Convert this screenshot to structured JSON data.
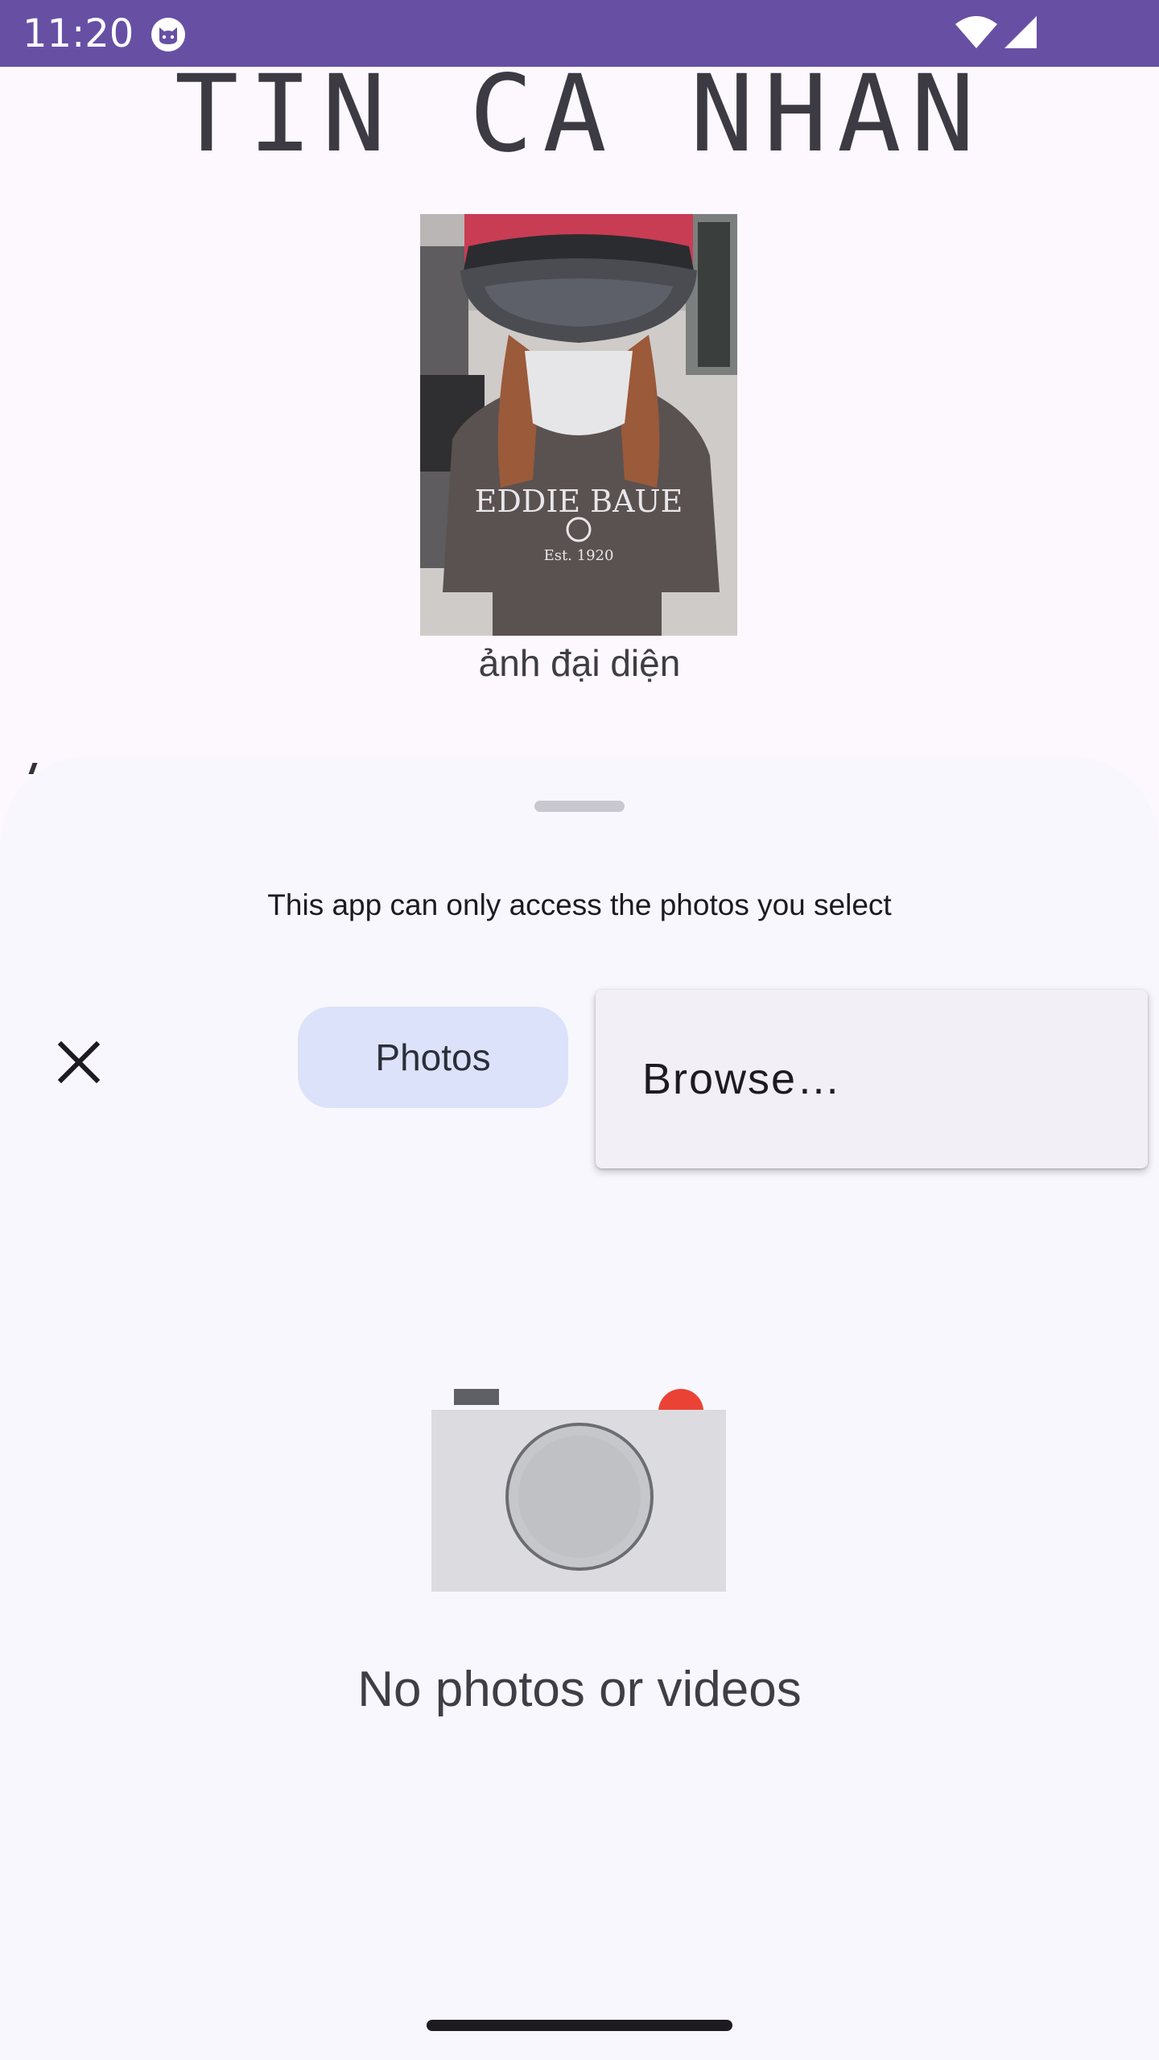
{
  "status_bar": {
    "time": "11:20",
    "background_color": "#6750a4",
    "icons": [
      "cat-notification-icon",
      "wifi-icon",
      "cellular-signal-icon"
    ]
  },
  "page": {
    "title": "TIN CÁ NHÂN",
    "avatar_caption": "ảnh đại diện"
  },
  "photo_picker": {
    "notice": "This app can only access the photos you select",
    "close_icon": "close-icon",
    "tabs": [
      {
        "label": "Photos",
        "selected": true
      }
    ],
    "overflow_menu": {
      "items": [
        {
          "label": "Browse…"
        }
      ]
    },
    "empty_state": {
      "illustration": "camera-icon",
      "message": "No photos or videos"
    },
    "accent_colors": {
      "selected_tab": "#dce2f9",
      "sheet_background": "#f8f7fd",
      "camera_dot": "#ea4335"
    }
  }
}
